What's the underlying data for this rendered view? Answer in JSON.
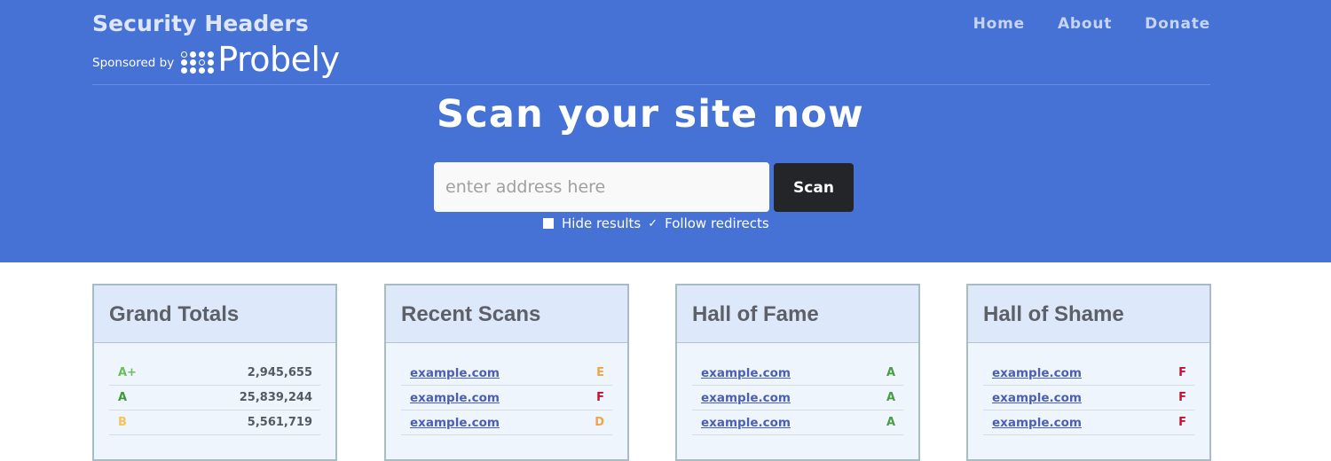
{
  "header": {
    "brand_title": "Security Headers",
    "sponsor_label": "Sponsored by",
    "sponsor_name": "Probely",
    "nav": [
      {
        "label": "Home"
      },
      {
        "label": "About"
      },
      {
        "label": "Donate"
      }
    ]
  },
  "hero": {
    "headline": "Scan your site now",
    "search": {
      "placeholder": "enter address here",
      "value": ""
    },
    "scan_label": "Scan",
    "options": {
      "hide_results": {
        "label": "Hide results",
        "checked": false
      },
      "follow_redirects": {
        "label": "Follow redirects",
        "checked": true
      }
    }
  },
  "panels": [
    {
      "title": "Grand Totals",
      "rows": [
        {
          "grade": "A+",
          "count": "2,945,655",
          "color": "#6cbd5b"
        },
        {
          "grade": "A",
          "count": "25,839,244",
          "color": "#3f9a3a"
        },
        {
          "grade": "B",
          "count": "5,561,719",
          "color": "#f6c35a"
        }
      ]
    },
    {
      "title": "Recent Scans",
      "rows": [
        {
          "site": "example.com",
          "grade": "E",
          "color": "#eca54c"
        },
        {
          "site": "example.com",
          "grade": "F",
          "color": "#c8102e"
        },
        {
          "site": "example.com",
          "grade": "D",
          "color": "#eca54c"
        }
      ]
    },
    {
      "title": "Hall of Fame",
      "rows": [
        {
          "site": "example.com",
          "grade": "A",
          "color": "#4a9c45"
        },
        {
          "site": "example.com",
          "grade": "A",
          "color": "#4a9c45"
        },
        {
          "site": "example.com",
          "grade": "A",
          "color": "#4a9c45"
        }
      ]
    },
    {
      "title": "Hall of Shame",
      "rows": [
        {
          "site": "example.com",
          "grade": "F",
          "color": "#c8102e"
        },
        {
          "site": "example.com",
          "grade": "F",
          "color": "#c8102e"
        },
        {
          "site": "example.com",
          "grade": "F",
          "color": "#c8102e"
        }
      ]
    }
  ],
  "colors": {
    "hero_bg": "#4671d5",
    "scan_button": "#232529",
    "panel_bg": "#eef5fd",
    "panel_header": "#dde9fb"
  }
}
